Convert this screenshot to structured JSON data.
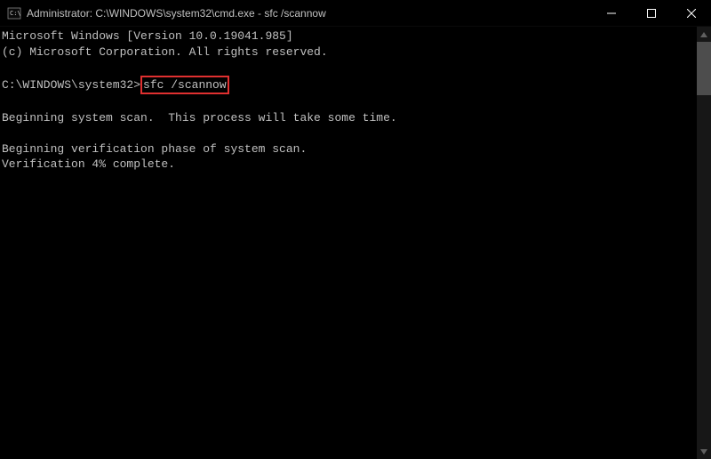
{
  "titlebar": {
    "title": "Administrator: C:\\WINDOWS\\system32\\cmd.exe - sfc  /scannow"
  },
  "terminal": {
    "line1": "Microsoft Windows [Version 10.0.19041.985]",
    "line2": "(c) Microsoft Corporation. All rights reserved.",
    "prompt": "C:\\WINDOWS\\system32>",
    "command": "sfc /scannow",
    "line_scan": "Beginning system scan.  This process will take some time.",
    "line_verify1": "Beginning verification phase of system scan.",
    "line_verify2": "Verification 4% complete."
  },
  "window_controls": {
    "minimize": "minimize",
    "maximize": "maximize",
    "close": "close"
  }
}
